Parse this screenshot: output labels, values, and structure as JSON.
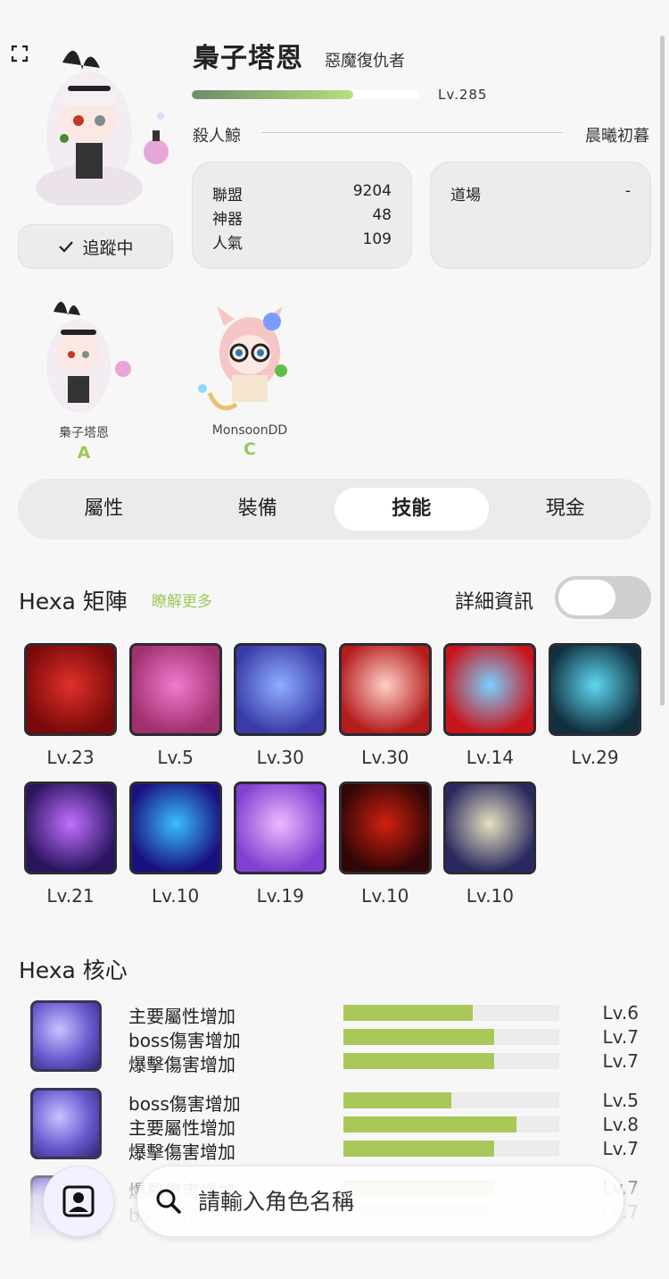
{
  "profile": {
    "name": "梟子塔恩",
    "class": "惡魔復仇者",
    "level": "Lv.285",
    "exp_fraction": 0.71,
    "guild": "殺人鯨",
    "world": "晨曦初暮",
    "track_label": "追蹤中"
  },
  "stats": {
    "union_label": "聯盟",
    "union_value": "9204",
    "artifact_label": "神器",
    "artifact_value": "48",
    "fame_label": "人氣",
    "fame_value": "109",
    "dojo_label": "道場",
    "dojo_value": "-"
  },
  "characters": [
    {
      "name": "梟子塔恩",
      "grade": "A"
    },
    {
      "name": "MonsoonDD",
      "grade": "C"
    }
  ],
  "tabs": [
    {
      "label": "屬性"
    },
    {
      "label": "裝備"
    },
    {
      "label": "技能"
    },
    {
      "label": "現金"
    }
  ],
  "active_tab": "技能",
  "hexa_matrix": {
    "title": "Hexa 矩陣",
    "learn_more": "瞭解更多",
    "detail_label": "詳細資訊",
    "detail_on": false,
    "skills": [
      {
        "level": "Lv.23",
        "colors": [
          "#7a0a0a",
          "#e0302a"
        ]
      },
      {
        "level": "Lv.5",
        "colors": [
          "#a0306e",
          "#f27ad0"
        ]
      },
      {
        "level": "Lv.30",
        "colors": [
          "#3a3aa8",
          "#8fb0ff"
        ]
      },
      {
        "level": "Lv.30",
        "colors": [
          "#b51c1c",
          "#ffd0c8"
        ]
      },
      {
        "level": "Lv.14",
        "colors": [
          "#c8141c",
          "#7ad0ff"
        ]
      },
      {
        "level": "Lv.29",
        "colors": [
          "#103040",
          "#5fd8f0"
        ]
      },
      {
        "level": "Lv.21",
        "colors": [
          "#2a1460",
          "#c070ff"
        ]
      },
      {
        "level": "Lv.10",
        "colors": [
          "#1a1080",
          "#38c0ff"
        ]
      },
      {
        "level": "Lv.19",
        "colors": [
          "#8040d0",
          "#f0b8ff"
        ]
      },
      {
        "level": "Lv.10",
        "colors": [
          "#300606",
          "#d02010"
        ]
      },
      {
        "level": "Lv.10",
        "colors": [
          "#2a2a60",
          "#e8e0c0"
        ]
      }
    ]
  },
  "hexa_core": {
    "title": "Hexa 核心",
    "cores": [
      {
        "rows": [
          {
            "label": "主要屬性增加",
            "level": "Lv.6",
            "fill": 0.6
          },
          {
            "label": "boss傷害增加",
            "level": "Lv.7",
            "fill": 0.7
          },
          {
            "label": "爆擊傷害增加",
            "level": "Lv.7",
            "fill": 0.7
          }
        ]
      },
      {
        "rows": [
          {
            "label": "boss傷害增加",
            "level": "Lv.5",
            "fill": 0.5
          },
          {
            "label": "主要屬性增加",
            "level": "Lv.8",
            "fill": 0.8
          },
          {
            "label": "爆擊傷害增加",
            "level": "Lv.7",
            "fill": 0.7
          }
        ]
      },
      {
        "rows": [
          {
            "label": "爆擊傷害增加",
            "level": "Lv.7",
            "fill": 0.7
          },
          {
            "label": "boss傷害增加",
            "level": "Lv.7",
            "fill": 0.7
          }
        ]
      }
    ]
  },
  "search": {
    "placeholder": "請輸入角色名稱"
  }
}
